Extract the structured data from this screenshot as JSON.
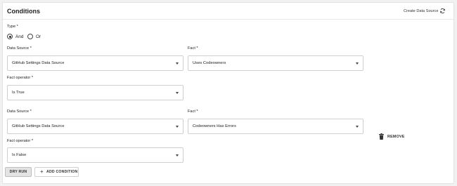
{
  "header": {
    "title": "Conditions",
    "create_link": "Create Data Source"
  },
  "type": {
    "label": "Type *",
    "options": [
      {
        "label": "And",
        "selected": true
      },
      {
        "label": "Or",
        "selected": false
      }
    ]
  },
  "conditions": [
    {
      "data_source_label": "Data Source *",
      "data_source_value": "GitHub Settings Data Source",
      "fact_label": "Fact *",
      "fact_value": "Uses Codeowners",
      "operator_label": "Fact operator *",
      "operator_value": "Is True"
    },
    {
      "data_source_label": "Data Source *",
      "data_source_value": "GitHub Settings Data Source",
      "fact_label": "Fact *",
      "fact_value": "Codeowners Has Errors",
      "operator_label": "Fact operator *",
      "operator_value": "Is False",
      "remove_label": "REMOVE"
    }
  ],
  "actions": {
    "dry_run": "DRY RUN",
    "add_condition": "ADD CONDITION"
  }
}
